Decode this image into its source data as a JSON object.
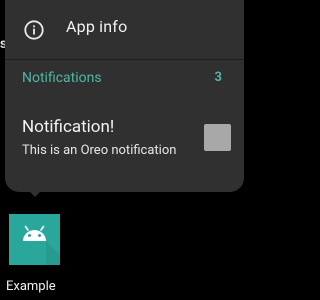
{
  "shortcut_menu": {
    "app_info_label": "App info",
    "notifications_header": "Notifications",
    "notifications_count": "3",
    "notification": {
      "title": "Notification!",
      "text": "This is an Oreo notification"
    }
  },
  "launcher": {
    "app_label": "Example"
  },
  "edge_text": "s",
  "colors": {
    "accent": "#4fb5a6",
    "popup_bg": "#303030",
    "icon_bg": "#2aa79b",
    "android_green": "#ffffff"
  },
  "icons": {
    "info": "info-circle-icon",
    "android": "android-icon"
  }
}
